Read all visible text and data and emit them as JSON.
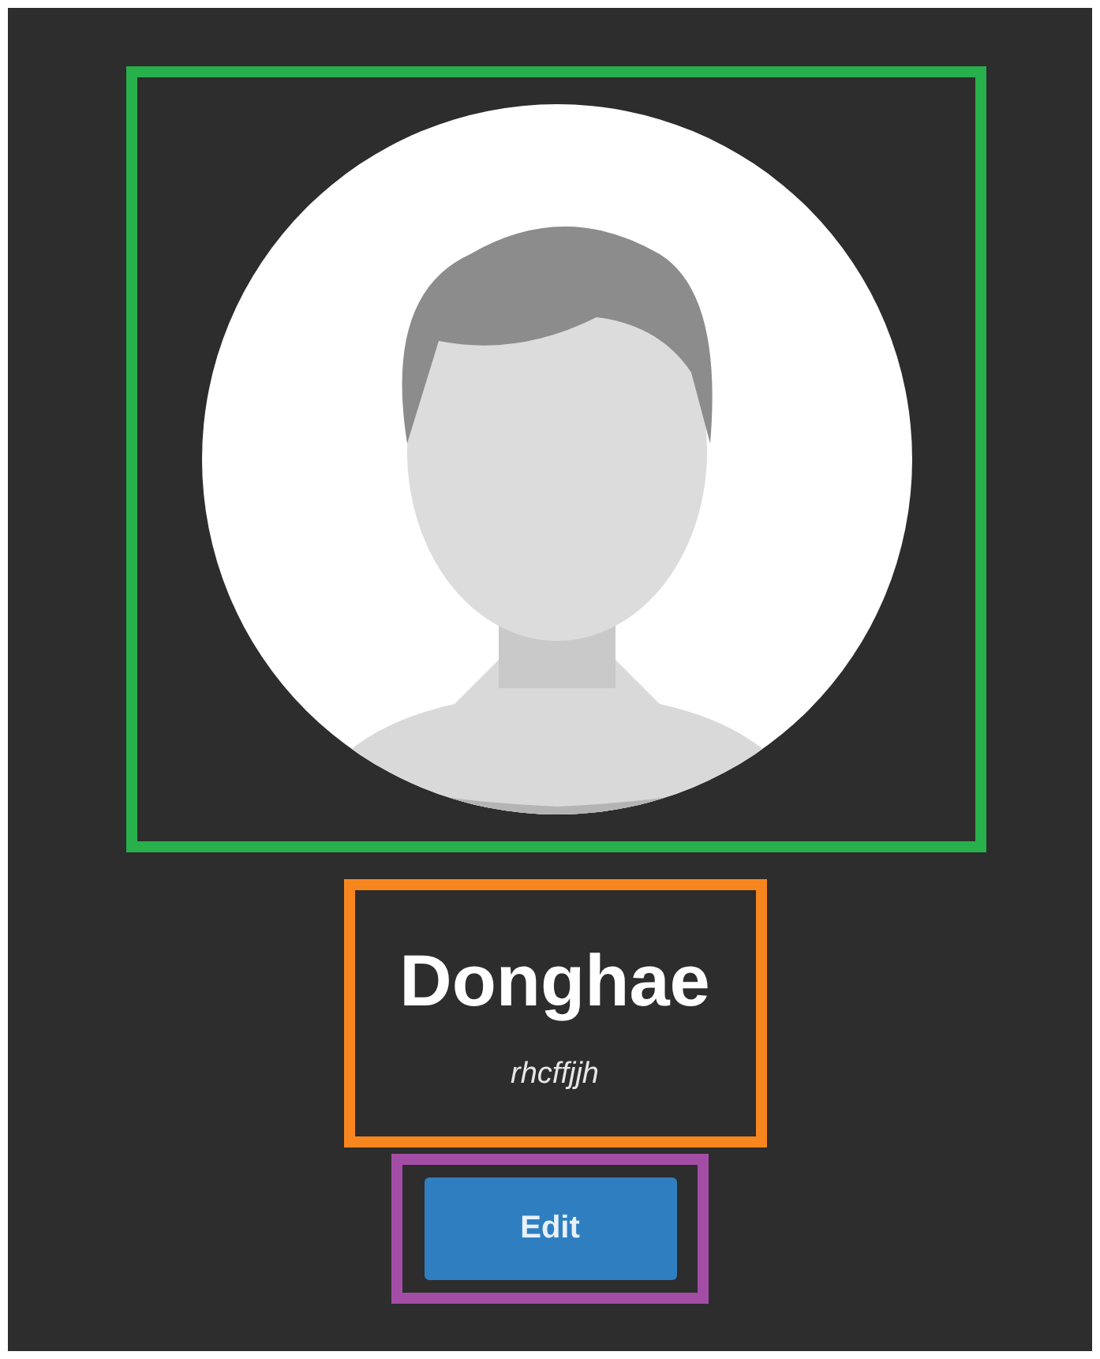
{
  "regions": [
    {
      "kind": "avatar",
      "color": "#27b04b"
    },
    {
      "kind": "identity",
      "name": "Donghae",
      "username": "rhcffjjh",
      "color": "#f8861f"
    },
    {
      "kind": "actions",
      "button": "Edit",
      "color": "#a44da6"
    }
  ]
}
